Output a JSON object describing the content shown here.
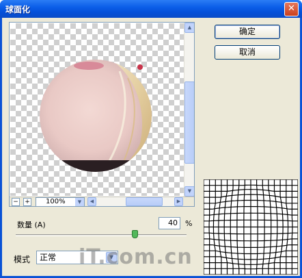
{
  "window": {
    "title": "球面化",
    "close_glyph": "✕"
  },
  "buttons": {
    "ok": "确定",
    "cancel": "取消"
  },
  "preview": {
    "zoom_out": "−",
    "zoom_in": "+",
    "zoom_value": "100%"
  },
  "amount": {
    "label": "数量 (A)",
    "value": "40",
    "unit": "%",
    "slider_fraction": 0.7
  },
  "mode": {
    "label": "模式",
    "value": "正常"
  },
  "watermark": "iT.com.cn",
  "colors": {
    "title_bar": "#0a52d6",
    "client_bg": "#ece9d8",
    "slider_thumb": "#53b85b"
  },
  "icons": {
    "close": "close-icon",
    "zoom_out": "zoom-out-icon",
    "zoom_in": "zoom-in-icon",
    "dropdown": "chevron-down-icon"
  }
}
